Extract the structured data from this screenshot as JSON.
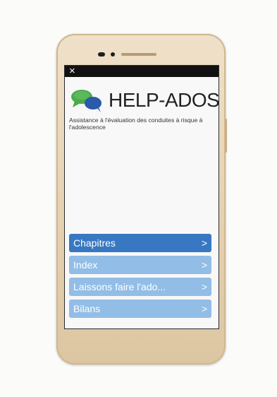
{
  "app": {
    "title": "HELP-ADOS",
    "subtitle": "Assistance à l'évaluation des conduites à risque à l'adolescence"
  },
  "statusbar": {
    "close_glyph": "×"
  },
  "menu": {
    "items": [
      {
        "label": "Chapitres",
        "active": true
      },
      {
        "label": "Index",
        "active": false
      },
      {
        "label": "Laissons faire l'ado...",
        "active": false
      },
      {
        "label": "Bilans",
        "active": false
      }
    ],
    "chevron_glyph": ">"
  },
  "colors": {
    "menu_active": "#3878c2",
    "menu_inactive": "#92bde6",
    "logo_green": "#4aac4a",
    "logo_blue": "#2a5aa8",
    "phone_body": "#e6d3b3"
  },
  "icons": {
    "logo": "speech-bubbles-icon",
    "close": "close-icon",
    "chevron": "chevron-right-icon"
  }
}
